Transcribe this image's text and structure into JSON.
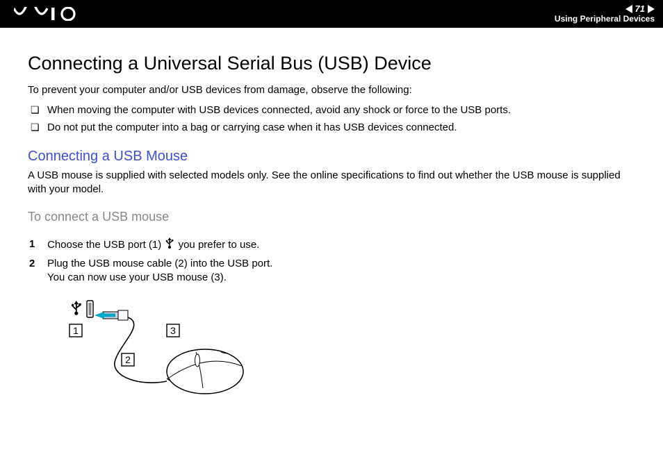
{
  "header": {
    "page_number": "71",
    "section": "Using Peripheral Devices"
  },
  "title": "Connecting a Universal Serial Bus (USB) Device",
  "intro": "To prevent your computer and/or USB devices from damage, observe the following:",
  "bullets": [
    "When moving the computer with USB devices connected, avoid any shock or force to the USB ports.",
    "Do not put the computer into a bag or carrying case when it has USB devices connected."
  ],
  "subheading": "Connecting a USB Mouse",
  "sub_paragraph": "A USB mouse is supplied with selected models only. See the online specifications to find out whether the USB mouse is supplied with your model.",
  "task_heading": "To connect a USB mouse",
  "steps": {
    "s1_a": "Choose the USB port (1) ",
    "s1_b": " you prefer to use.",
    "s2_a": "Plug the USB mouse cable (2) into the USB port.",
    "s2_b": "You can now use your USB mouse (3)."
  },
  "diagram_labels": {
    "l1": "1",
    "l2": "2",
    "l3": "3"
  }
}
